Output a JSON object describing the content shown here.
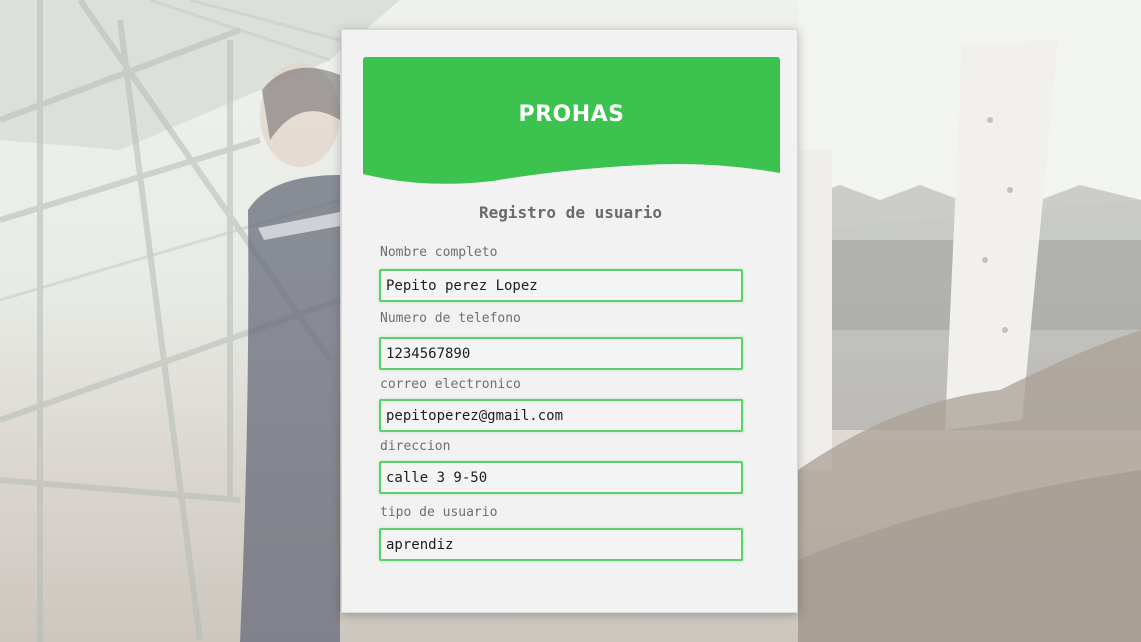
{
  "brand": {
    "name": "PROHAS",
    "color": "#3cc24e"
  },
  "form": {
    "title": "Registro de usuario",
    "accent_color": "#5bd06a",
    "fields": [
      {
        "label": "Nombre completo",
        "value": "Pepito perez Lopez"
      },
      {
        "label": "Numero de telefono",
        "value": "1234567890"
      },
      {
        "label": "correo electronico",
        "value": "pepitoperez@gmail.com"
      },
      {
        "label": "direccion",
        "value": "calle 3 9-50"
      },
      {
        "label": "tipo de usuario",
        "value": "aprendiz"
      }
    ]
  }
}
